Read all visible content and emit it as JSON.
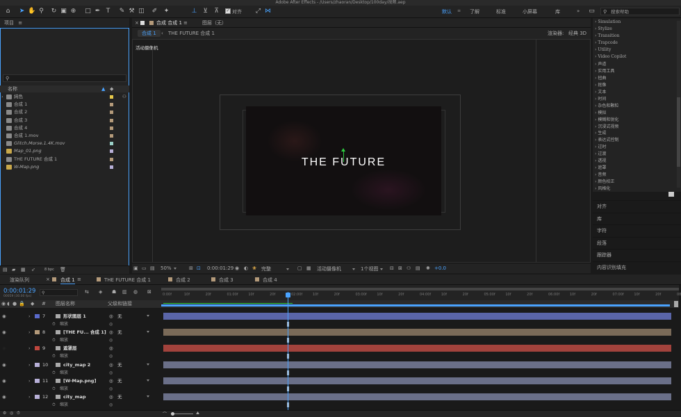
{
  "app": {
    "title": "Adobe After Effects - /Users/zhaoran/Desktop/100day/视频.aep"
  },
  "toolbar": {
    "align_label": "对齐",
    "workspaces": [
      "默认",
      "了解",
      "标准",
      "小屏幕",
      "库"
    ],
    "search_placeholder": "搜索帮助"
  },
  "project": {
    "title": "项目",
    "col_name": "名称",
    "items": [
      {
        "name": "純色",
        "type": "folder",
        "color": "#e6c84a"
      },
      {
        "name": "合成 1",
        "type": "comp",
        "color": "#b49a7a"
      },
      {
        "name": "合成 2",
        "type": "comp",
        "color": "#b49a7a"
      },
      {
        "name": "合成 3",
        "type": "comp",
        "color": "#b49a7a"
      },
      {
        "name": "合成 4",
        "type": "comp",
        "color": "#b49a7a"
      },
      {
        "name": "合成 1.mov",
        "type": "video",
        "color": "#b49a7a"
      },
      {
        "name": "Glitch.Morse.1.4K.mov",
        "type": "video",
        "color": "#9ad0c8"
      },
      {
        "name": "Map_01.png",
        "type": "image",
        "color": "#b8b0d8"
      },
      {
        "name": "THE FUTURE 合成 1",
        "type": "comp",
        "color": "#b49a7a"
      },
      {
        "name": "W-Map.png",
        "type": "image",
        "color": "#b8b0d8"
      }
    ],
    "bpc": "8 bpc"
  },
  "composition": {
    "panel_title": "合成 合成 1",
    "layer_label": "图层（无）",
    "tabs": [
      "合成 1",
      "THE FUTURE 合成 1"
    ],
    "renderer_label": "渲染器:",
    "renderer_value": "经典 3D",
    "camera_label": "活动摄像机",
    "frame_text": "THE FUTURE"
  },
  "viewer_footer": {
    "zoom": "50%",
    "timecode": "0:00:01:29",
    "quality": "完整",
    "camera": "活动摄像机",
    "views": "1个视图",
    "exposure": "+0.0"
  },
  "effects": {
    "items": [
      "Simulation",
      "Stylize",
      "Transition",
      "Trapcode",
      "Utility",
      "Video Copilot",
      "声道",
      "实用工具",
      "扭曲",
      "抠像",
      "文本",
      "时间",
      "杂色和颗粒",
      "模拟",
      "模糊和锐化",
      "沉浸式视频",
      "生成",
      "表达式控制",
      "过时",
      "过渡",
      "透视",
      "遮罩",
      "音频",
      "颜色校正",
      "风格化"
    ]
  },
  "right_panels": [
    "对齐",
    "库",
    "字符",
    "段落",
    "跟踪器",
    "内容识别填充"
  ],
  "timeline": {
    "tabs": [
      "渲染队列",
      "合成 1",
      "THE FUTURE 合成 1",
      "合成 2",
      "合成 3",
      "合成 4"
    ],
    "active_tab": "合成 1",
    "timecode": "0:00:01:29",
    "timecode_sub": "00059 (30.00 fps)",
    "col_layer_name": "图层名称",
    "col_parent": "父级和链接",
    "ruler_labels": [
      "0:00f",
      "10f",
      "20f",
      "01:00f",
      "10f",
      "20f",
      "02:00f",
      "10f",
      "20f",
      "03:00f",
      "10f",
      "20f",
      "04:00f",
      "10f",
      "20f",
      "05:00f",
      "10f",
      "20f",
      "06:00f",
      "10f",
      "20f",
      "07:00f",
      "10f",
      "20f",
      "08:0"
    ],
    "layers": [
      {
        "num": "7",
        "name": "形状图层 1",
        "parent": "无",
        "sub": "缩放",
        "label_color": "#5a6acb",
        "bar_color": "#5a65a8"
      },
      {
        "num": "8",
        "name": "[THE FU... 合成 1]",
        "parent": "无",
        "sub": "缩放",
        "label_color": "#b49a7a",
        "bar_color": "#7a6a58"
      },
      {
        "num": "9",
        "name": "遮罩层",
        "parent": "",
        "sub": "缩放",
        "label_color": "#c0473e",
        "bar_color": "#a2423c"
      },
      {
        "num": "10",
        "name": "city_map 2",
        "parent": "无",
        "sub": "缩放",
        "label_color": "#b8b0d8",
        "bar_color": "#6a6f88"
      },
      {
        "num": "11",
        "name": "[W-Map.png]",
        "parent": "无",
        "sub": "缩放",
        "label_color": "#b8b0d8",
        "bar_color": "#6a6f88"
      },
      {
        "num": "12",
        "name": "city_map",
        "parent": "无",
        "sub": "缩放",
        "label_color": "#b8b0d8",
        "bar_color": "#6a6f88"
      }
    ]
  }
}
